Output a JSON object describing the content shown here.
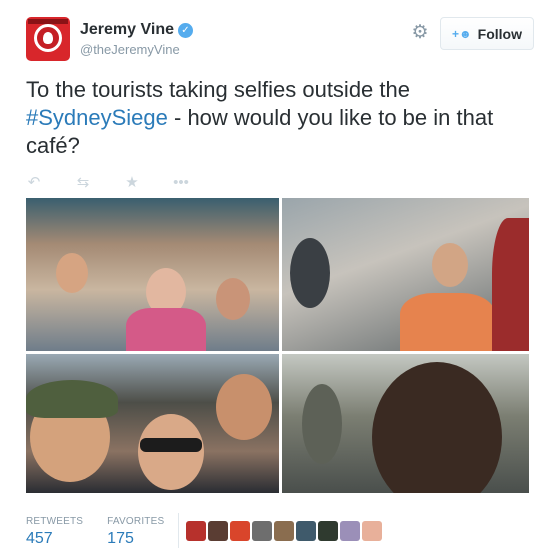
{
  "user": {
    "display_name": "Jeremy Vine",
    "handle": "@theJeremyVine",
    "verified_glyph": "✓",
    "avatar_color": "#d8262b"
  },
  "header": {
    "settings_icon": "gear-icon",
    "follow_label": "Follow",
    "follow_icon": "add-user-icon"
  },
  "tweet": {
    "text_before": "To the tourists taking selfies outside the",
    "hashtag": "#SydneySiege",
    "text_after": " - how would you like to be in that café?"
  },
  "actions": {
    "reply_icon": "reply-icon",
    "retweet_icon": "retweet-icon",
    "favorite_icon": "star-icon",
    "more_icon": "more-icon"
  },
  "media": {
    "photo_count": 4
  },
  "stats": {
    "retweets_label": "RETWEETS",
    "retweets_value": "457",
    "favorites_label": "FAVORITES",
    "favorites_value": "175"
  },
  "favoriter_avatar_colors": [
    "#b7312c",
    "#5a3d33",
    "#d9452b",
    "#6e6e6e",
    "#8a6d4f",
    "#3f5a6b",
    "#2f3a2f",
    "#9b8fb8",
    "#e8b09a"
  ],
  "colors": {
    "link": "#2b7bb9",
    "muted": "#8899a6",
    "text": "#292f33",
    "action_icon": "#ccd6dd"
  }
}
